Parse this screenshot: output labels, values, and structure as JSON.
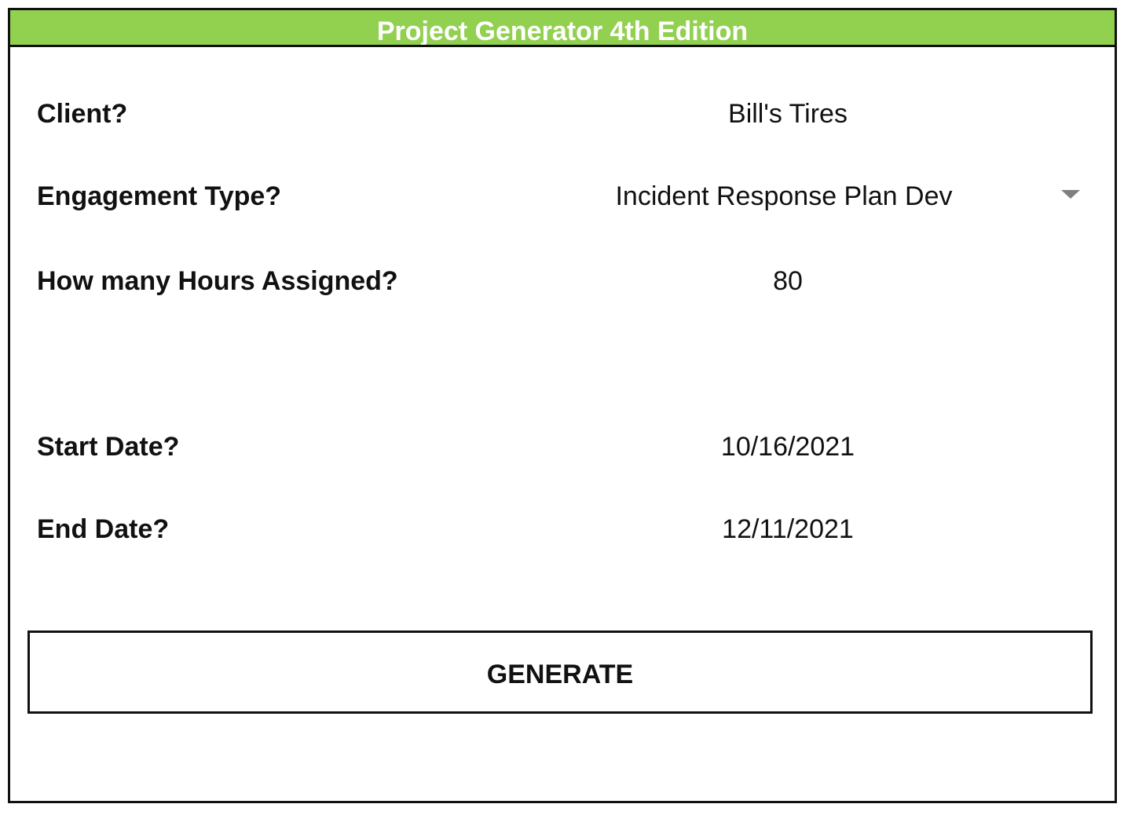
{
  "app": {
    "title": "Project Generator 4th Edition",
    "accent_color": "#92d050"
  },
  "form": {
    "client": {
      "label": "Client?",
      "value": "Bill's Tires"
    },
    "engagement_type": {
      "label": "Engagement Type?",
      "selected": "Incident Response Plan Dev",
      "icon": "chevron-down-icon"
    },
    "hours": {
      "label": "How many Hours Assigned?",
      "value": "80"
    },
    "start_date": {
      "label": "Start Date?",
      "value": "10/16/2021"
    },
    "end_date": {
      "label": "End Date?",
      "value": "12/11/2021"
    }
  },
  "actions": {
    "generate_label": "GENERATE"
  }
}
